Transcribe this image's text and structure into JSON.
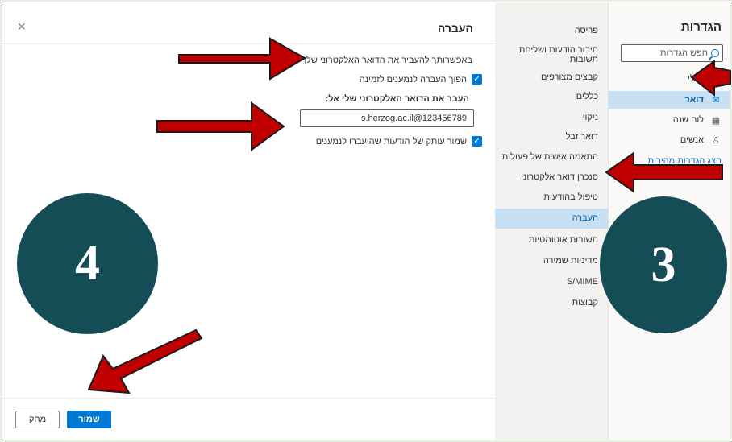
{
  "settings": {
    "title": "הגדרות",
    "search_placeholder": "חפש הגדרות",
    "items": [
      {
        "label": "כללי",
        "icon": "gear-icon",
        "selected": false
      },
      {
        "label": "דואר",
        "icon": "mail-icon",
        "selected": true
      },
      {
        "label": "לוח שנה",
        "icon": "calendar-icon",
        "selected": false
      },
      {
        "label": "אנשים",
        "icon": "people-icon",
        "selected": false
      }
    ],
    "quick_settings_link": "הצג הגדרות מהירות"
  },
  "mail_categories": [
    {
      "label": "פריסה"
    },
    {
      "label": "חיבור הודעות ושליחת תשובות"
    },
    {
      "label": "קבצים מצורפים"
    },
    {
      "label": "כללים"
    },
    {
      "label": "ניקוי"
    },
    {
      "label": "דואר זבל"
    },
    {
      "label": "התאמה אישית של פעולות"
    },
    {
      "label": "סנכרן דואר אלקטרוני"
    },
    {
      "label": "טיפול בהודעות"
    },
    {
      "label": "העברה",
      "selected": true
    },
    {
      "label": "תשובות אוטומטיות"
    },
    {
      "label": "מדיניות שמירה"
    },
    {
      "label": "S/MIME"
    },
    {
      "label": "קבוצות"
    }
  ],
  "forwarding": {
    "title": "העברה",
    "intro": "באפשרותך להעביר את הדואר האלקטרוני שלך לחשבון",
    "enable_checkbox_label": "הפוך העברה לנמענים לזמינה",
    "enable_checked": true,
    "forward_to_label": "העבר את הדואר האלקטרוני שלי אל:",
    "forward_to_value": "s.herzog.ac.il@123456789",
    "keep_copy_label": "שמור עותק של הודעות שהועברו לנמענים",
    "keep_copy_checked": true,
    "save_label": "שמור",
    "discard_label": "מחק"
  },
  "annotations": {
    "step_left": "4",
    "step_right": "3",
    "arrow_color": "#c00000",
    "circle_color": "#154d57"
  }
}
